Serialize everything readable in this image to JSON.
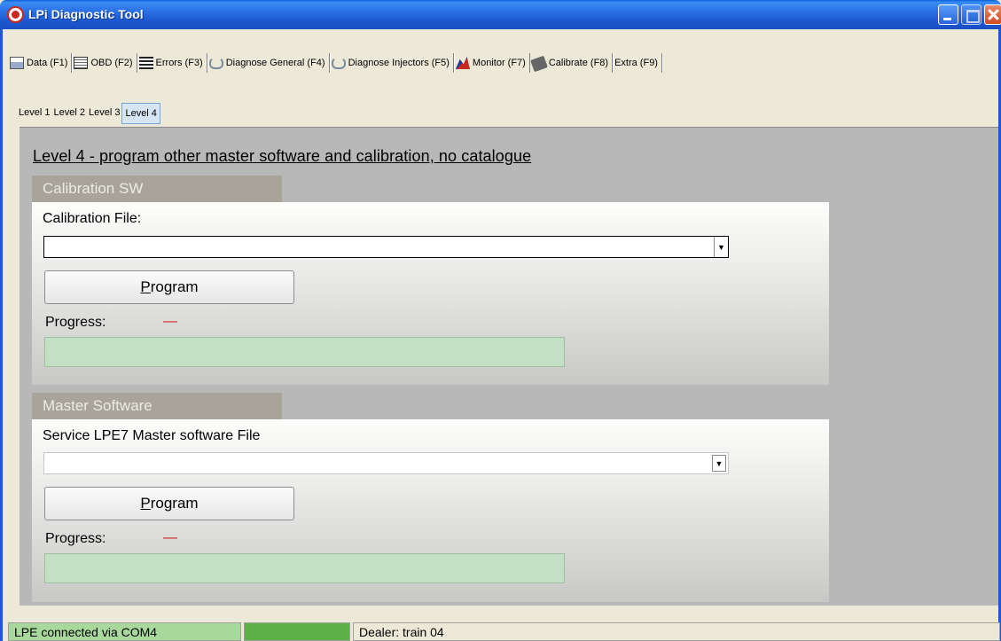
{
  "window": {
    "title": "LPi Diagnostic Tool"
  },
  "main_tabs": [
    {
      "label": "Data (F1)",
      "icon": "data-icon"
    },
    {
      "label": "OBD (F2)",
      "icon": "obd-icon"
    },
    {
      "label": "Errors (F3)",
      "icon": "errors-icon"
    },
    {
      "label": "Diagnose General (F4)",
      "icon": "stethoscope-icon"
    },
    {
      "label": "Diagnose Injectors (F5)",
      "icon": "stethoscope-icon"
    },
    {
      "label": "Monitor (F7)",
      "icon": "monitor-chart-icon"
    },
    {
      "label": "Calibrate (F8)",
      "icon": "chip-icon",
      "active": true
    },
    {
      "label": "Extra (F9)",
      "icon": ""
    }
  ],
  "sub_tabs": [
    {
      "label": "Level 1"
    },
    {
      "label": "Level 2"
    },
    {
      "label": "Level 3"
    },
    {
      "label": "Level 4",
      "active": true
    }
  ],
  "content": {
    "heading": "Level 4 - program other master software and calibration, no catalogue",
    "calibration": {
      "group_title": "Calibration SW",
      "file_label": "Calibration File:",
      "file_value": "",
      "button_prefix": "",
      "button_mnemonic": "P",
      "button_rest": "rogram",
      "progress_label": "Progress:",
      "progress_value": "—",
      "progress_fraction": 0
    },
    "master": {
      "group_title": "Master Software",
      "file_label": "Service LPE7 Master software File",
      "file_value": "",
      "button_prefix": "",
      "button_mnemonic": "P",
      "button_rest": "rogram",
      "progress_label": "Progress:",
      "progress_value": "—",
      "progress_fraction": 0
    }
  },
  "status_bar": {
    "connection": "LPE connected via COM4",
    "dealer": "Dealer: train 04"
  },
  "colors": {
    "titlebar": "#1c58d0",
    "connection_ok": "#5cb046",
    "progress_bg": "#c3dfc6",
    "group_title_bg": "#a8a499",
    "progress_dash": "#d21e1e"
  }
}
